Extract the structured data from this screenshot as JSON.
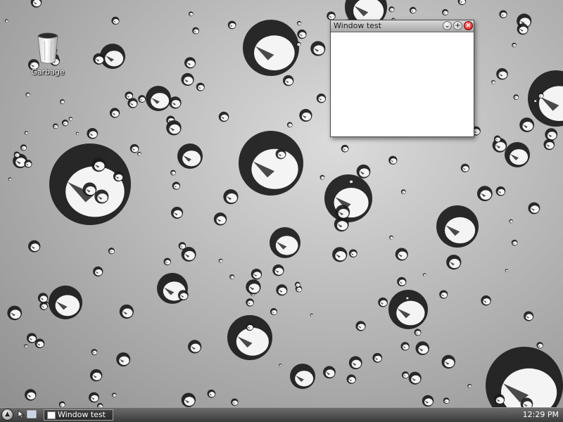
{
  "desktop": {
    "icons": [
      {
        "label": "Garbage",
        "icon": "trash-can-icon"
      }
    ]
  },
  "window": {
    "title": "Window test",
    "buttons": {
      "minimize": "⌄",
      "maximize": "+",
      "close": "×"
    }
  },
  "taskbar": {
    "start_icon": "▲",
    "tasks": [
      {
        "label": "Window test"
      }
    ],
    "clock": "12:29 PM"
  },
  "colors": {
    "close": "#d01010",
    "taskbar": "#3b3b3b"
  }
}
